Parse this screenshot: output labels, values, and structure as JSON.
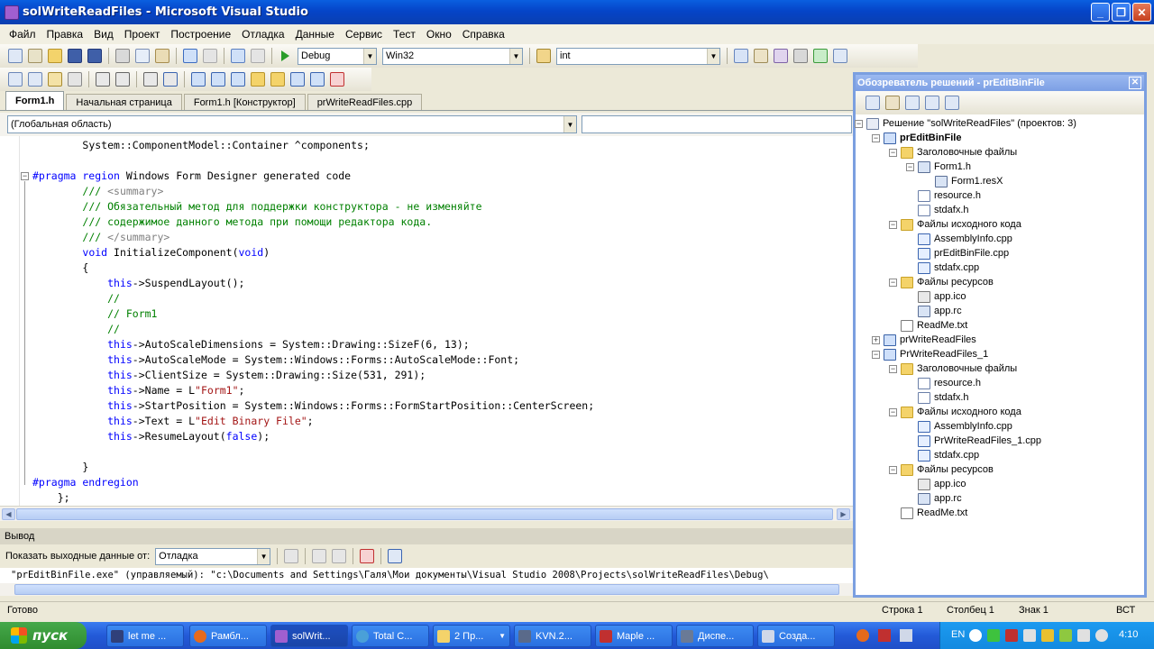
{
  "window": {
    "title": "solWriteReadFiles - Microsoft Visual Studio"
  },
  "menu": [
    "Файл",
    "Правка",
    "Вид",
    "Проект",
    "Построение",
    "Отладка",
    "Данные",
    "Сервис",
    "Тест",
    "Окно",
    "Справка"
  ],
  "toolbar": {
    "config": "Debug",
    "platform": "Win32",
    "find": "int"
  },
  "tabs": [
    {
      "label": "Form1.h",
      "active": true
    },
    {
      "label": "Начальная страница",
      "active": false
    },
    {
      "label": "Form1.h [Конструктор]",
      "active": false
    },
    {
      "label": "prWriteReadFiles.cpp",
      "active": false
    }
  ],
  "scope": {
    "left": "(Глобальная область)",
    "right": ""
  },
  "code": [
    {
      "indent": "        ",
      "parts": [
        {
          "t": "System::ComponentModel::Container ^components;",
          "c": ""
        }
      ]
    },
    {
      "indent": "",
      "parts": []
    },
    {
      "indent": "",
      "parts": [
        {
          "t": "#pragma region",
          "c": "kw"
        },
        {
          "t": " Windows Form Designer generated code",
          "c": ""
        }
      ]
    },
    {
      "indent": "        ",
      "parts": [
        {
          "t": "/// ",
          "c": "cm"
        },
        {
          "t": "<summary>",
          "c": "xm"
        }
      ]
    },
    {
      "indent": "        ",
      "parts": [
        {
          "t": "/// Обязательный метод для поддержки конструктора - не изменяйте",
          "c": "cm"
        }
      ]
    },
    {
      "indent": "        ",
      "parts": [
        {
          "t": "/// содержимое данного метода при помощи редактора кода.",
          "c": "cm"
        }
      ]
    },
    {
      "indent": "        ",
      "parts": [
        {
          "t": "/// ",
          "c": "cm"
        },
        {
          "t": "</summary>",
          "c": "xm"
        }
      ]
    },
    {
      "indent": "        ",
      "parts": [
        {
          "t": "void",
          "c": "kw"
        },
        {
          "t": " InitializeComponent(",
          "c": ""
        },
        {
          "t": "void",
          "c": "kw"
        },
        {
          "t": ")",
          "c": ""
        }
      ]
    },
    {
      "indent": "        ",
      "parts": [
        {
          "t": "{",
          "c": ""
        }
      ]
    },
    {
      "indent": "            ",
      "parts": [
        {
          "t": "this",
          "c": "kw"
        },
        {
          "t": "->SuspendLayout();",
          "c": ""
        }
      ]
    },
    {
      "indent": "            ",
      "parts": [
        {
          "t": "//",
          "c": "cm"
        }
      ]
    },
    {
      "indent": "            ",
      "parts": [
        {
          "t": "// Form1",
          "c": "cm"
        }
      ]
    },
    {
      "indent": "            ",
      "parts": [
        {
          "t": "//",
          "c": "cm"
        }
      ]
    },
    {
      "indent": "            ",
      "parts": [
        {
          "t": "this",
          "c": "kw"
        },
        {
          "t": "->AutoScaleDimensions = System::Drawing::SizeF(6, 13);",
          "c": ""
        }
      ]
    },
    {
      "indent": "            ",
      "parts": [
        {
          "t": "this",
          "c": "kw"
        },
        {
          "t": "->AutoScaleMode = System::Windows::Forms::AutoScaleMode::Font;",
          "c": ""
        }
      ]
    },
    {
      "indent": "            ",
      "parts": [
        {
          "t": "this",
          "c": "kw"
        },
        {
          "t": "->ClientSize = System::Drawing::Size(531, 291);",
          "c": ""
        }
      ]
    },
    {
      "indent": "            ",
      "parts": [
        {
          "t": "this",
          "c": "kw"
        },
        {
          "t": "->Name = L",
          "c": ""
        },
        {
          "t": "\"Form1\"",
          "c": "st"
        },
        {
          "t": ";",
          "c": ""
        }
      ]
    },
    {
      "indent": "            ",
      "parts": [
        {
          "t": "this",
          "c": "kw"
        },
        {
          "t": "->StartPosition = System::Windows::Forms::FormStartPosition::CenterScreen;",
          "c": ""
        }
      ]
    },
    {
      "indent": "            ",
      "parts": [
        {
          "t": "this",
          "c": "kw"
        },
        {
          "t": "->Text = L",
          "c": ""
        },
        {
          "t": "\"Edit Binary File\"",
          "c": "st"
        },
        {
          "t": ";",
          "c": ""
        }
      ]
    },
    {
      "indent": "            ",
      "parts": [
        {
          "t": "this",
          "c": "kw"
        },
        {
          "t": "->ResumeLayout(",
          "c": ""
        },
        {
          "t": "false",
          "c": "kw"
        },
        {
          "t": ");",
          "c": ""
        }
      ]
    },
    {
      "indent": "",
      "parts": []
    },
    {
      "indent": "        ",
      "parts": [
        {
          "t": "}",
          "c": ""
        }
      ]
    },
    {
      "indent": "",
      "parts": [
        {
          "t": "#pragma endregion",
          "c": "kw"
        }
      ]
    },
    {
      "indent": "    ",
      "parts": [
        {
          "t": "};",
          "c": ""
        }
      ]
    }
  ],
  "output": {
    "header": "Вывод",
    "show_label": "Показать выходные данные от:",
    "source": "Отладка",
    "text": "\"prEditBinFile.exe\" (управляемый): \"c:\\Documents and Settings\\Галя\\Мои документы\\Visual Studio 2008\\Projects\\solWriteReadFiles\\Debug\\"
  },
  "solution_explorer": {
    "title": "Обозреватель решений - prEditBinFile",
    "items": [
      {
        "label": "Решение \"solWriteReadFiles\" (проектов: 3)",
        "level": 0,
        "icon": "solution-icon",
        "bold": false
      },
      {
        "label": "prEditBinFile",
        "level": 1,
        "icon": "project-icon",
        "bold": true
      },
      {
        "label": "Заголовочные файлы",
        "level": 2,
        "icon": "folder-icon",
        "bold": false
      },
      {
        "label": "Form1.h",
        "level": 3,
        "icon": "form-icon",
        "bold": false
      },
      {
        "label": "Form1.resX",
        "level": 4,
        "icon": "resx-icon",
        "bold": false
      },
      {
        "label": "resource.h",
        "level": 3,
        "icon": "header-file-icon",
        "bold": false
      },
      {
        "label": "stdafx.h",
        "level": 3,
        "icon": "header-file-icon",
        "bold": false
      },
      {
        "label": "Файлы исходного кода",
        "level": 2,
        "icon": "folder-icon",
        "bold": false
      },
      {
        "label": "AssemblyInfo.cpp",
        "level": 3,
        "icon": "cpp-file-icon",
        "bold": false
      },
      {
        "label": "prEditBinFile.cpp",
        "level": 3,
        "icon": "cpp-file-icon",
        "bold": false
      },
      {
        "label": "stdafx.cpp",
        "level": 3,
        "icon": "cpp-file-icon",
        "bold": false
      },
      {
        "label": "Файлы ресурсов",
        "level": 2,
        "icon": "folder-icon",
        "bold": false
      },
      {
        "label": "app.ico",
        "level": 3,
        "icon": "ico-file-icon",
        "bold": false
      },
      {
        "label": "app.rc",
        "level": 3,
        "icon": "rc-file-icon",
        "bold": false
      },
      {
        "label": "ReadMe.txt",
        "level": 2,
        "icon": "text-file-icon",
        "bold": false
      },
      {
        "label": "prWriteReadFiles",
        "level": 1,
        "icon": "project-icon",
        "bold": false
      },
      {
        "label": "PrWriteReadFiles_1",
        "level": 1,
        "icon": "project-icon",
        "bold": false
      },
      {
        "label": "Заголовочные файлы",
        "level": 2,
        "icon": "folder-icon",
        "bold": false
      },
      {
        "label": "resource.h",
        "level": 3,
        "icon": "header-file-icon",
        "bold": false
      },
      {
        "label": "stdafx.h",
        "level": 3,
        "icon": "header-file-icon",
        "bold": false
      },
      {
        "label": "Файлы исходного кода",
        "level": 2,
        "icon": "folder-icon",
        "bold": false
      },
      {
        "label": "AssemblyInfo.cpp",
        "level": 3,
        "icon": "cpp-file-icon",
        "bold": false
      },
      {
        "label": "PrWriteReadFiles_1.cpp",
        "level": 3,
        "icon": "cpp-file-icon",
        "bold": false
      },
      {
        "label": "stdafx.cpp",
        "level": 3,
        "icon": "cpp-file-icon",
        "bold": false
      },
      {
        "label": "Файлы ресурсов",
        "level": 2,
        "icon": "folder-icon",
        "bold": false
      },
      {
        "label": "app.ico",
        "level": 3,
        "icon": "ico-file-icon",
        "bold": false
      },
      {
        "label": "app.rc",
        "level": 3,
        "icon": "rc-file-icon",
        "bold": false
      },
      {
        "label": "ReadMe.txt",
        "level": 2,
        "icon": "text-file-icon",
        "bold": false
      }
    ]
  },
  "status": {
    "ready": "Готово",
    "line": "Строка 1",
    "col": "Столбец 1",
    "char": "Знак 1",
    "ins": "ВСТ"
  },
  "taskbar": {
    "start": "пуск",
    "tasks": [
      "let me ...",
      "Рамбл...",
      "solWrit...",
      "Total C...",
      "2 Пр...",
      "KVN.2...",
      "Maple ...",
      "Диспе...",
      "Созда..."
    ],
    "lang": "EN",
    "clock": "4:10"
  }
}
